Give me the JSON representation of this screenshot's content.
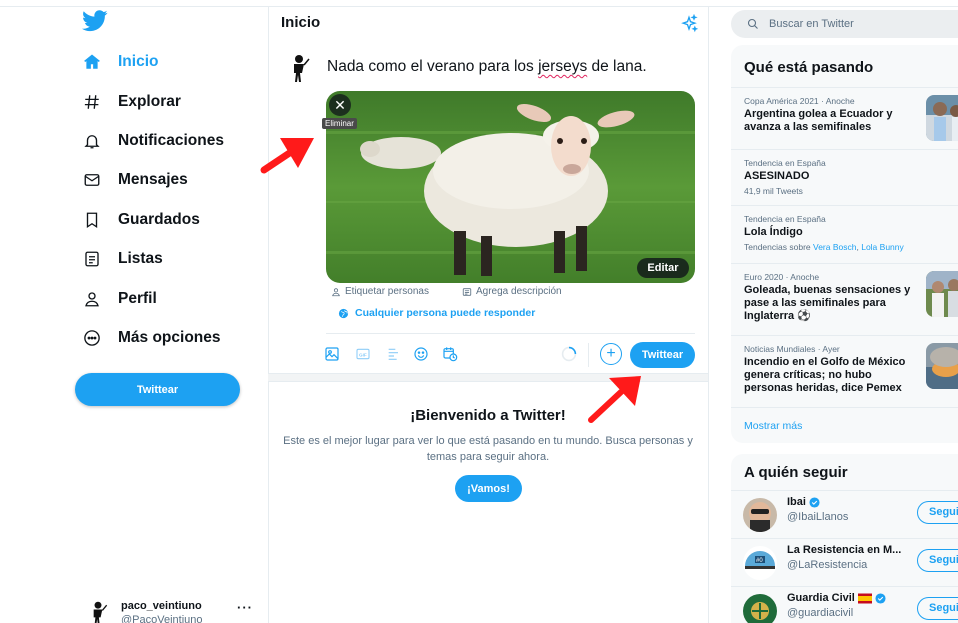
{
  "nav": {
    "items": [
      {
        "label": "Inicio",
        "icon": "home-icon"
      },
      {
        "label": "Explorar",
        "icon": "hashtag-icon"
      },
      {
        "label": "Notificaciones",
        "icon": "bell-icon"
      },
      {
        "label": "Mensajes",
        "icon": "envelope-icon"
      },
      {
        "label": "Guardados",
        "icon": "bookmark-icon"
      },
      {
        "label": "Listas",
        "icon": "list-icon"
      },
      {
        "label": "Perfil",
        "icon": "user-icon"
      },
      {
        "label": "Más opciones",
        "icon": "more-circle-icon"
      }
    ],
    "tweet_button": "Twittear",
    "account": {
      "name": "paco_veintiuno",
      "handle": "@PacoVeintiuno",
      "more": "···"
    }
  },
  "main": {
    "title": "Inicio",
    "compose": {
      "text_before": "Nada como el verano para los ",
      "text_misspelled": "jerseys",
      "text_after": " de lana.",
      "remove_tooltip": "Eliminar",
      "edit_label": "Editar",
      "tag_people": "Etiquetar personas",
      "add_description": "Agrega descripción",
      "reply_setting": "Cualquier persona puede responder",
      "submit_label": "Twittear",
      "plus_label": "+"
    },
    "welcome": {
      "title": "¡Bienvenido a Twitter!",
      "body": "Este es el mejor lugar para ver lo que está pasando en tu mundo. Busca personas y temas para seguir ahora.",
      "button": "¡Vamos!"
    }
  },
  "sidebar": {
    "search_placeholder": "Buscar en Twitter",
    "trends_title": "Qué está pasando",
    "trends": [
      {
        "meta": "Copa América 2021 · Anoche",
        "headline": "Argentina golea a Ecuador y avanza a las semifinales"
      },
      {
        "meta": "Tendencia en España",
        "headline": "ASESINADO",
        "sub": "41,9 mil Tweets"
      },
      {
        "meta": "Tendencia en España",
        "headline": "Lola Índigo",
        "sub_prefix": "Tendencias sobre ",
        "sub_link1": "Vera Bosch",
        "sub_link2": "Lola Bunny"
      },
      {
        "meta": "Euro 2020 · Anoche",
        "headline": "Goleada, buenas sensaciones y pase a las semifinales para Inglaterra ⚽"
      },
      {
        "meta": "Noticias Mundiales · Ayer",
        "headline": "Incendio en el Golfo de México genera críticas; no hubo personas heridas, dice Pemex"
      }
    ],
    "show_more": "Mostrar más",
    "who_to_follow_title": "A quién seguir",
    "follow": [
      {
        "name": "Ibai",
        "handle": "@IbaiLlanos",
        "button": "Seguir"
      },
      {
        "name": "La Resistencia en M...",
        "handle": "@LaResistencia",
        "button": "Seguir"
      },
      {
        "name": "Guardia Civil",
        "handle": "@guardiacivil",
        "button": "Seguir"
      }
    ]
  },
  "colors": {
    "accent": "#1da1f2",
    "annotation_arrow": "#ff1a1a"
  }
}
